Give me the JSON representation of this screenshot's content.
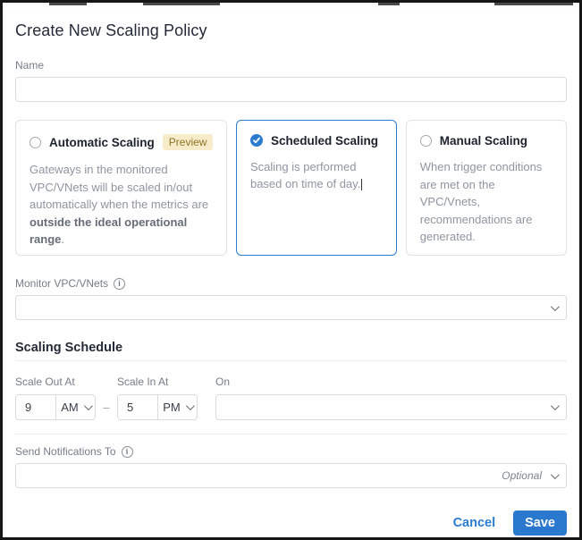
{
  "modal": {
    "title": "Create New Scaling Policy",
    "name_field": {
      "label": "Name",
      "value": ""
    },
    "policy_cards": [
      {
        "title": "Automatic Scaling",
        "badge": "Preview",
        "selected": false,
        "desc_normal": "Gateways in the monitored VPC/VNets will be scaled in/out automatically when the metrics are ",
        "desc_bold": "outside the ideal operational range",
        "desc_suffix": "."
      },
      {
        "title": "Scheduled Scaling",
        "selected": true,
        "description": "Scaling is performed based on time of day."
      },
      {
        "title": "Manual Scaling",
        "selected": false,
        "description": "When trigger conditions are met on the VPC/Vnets, recommendations are generated."
      }
    ],
    "monitor_field": {
      "label": "Monitor VPC/VNets",
      "value": ""
    },
    "schedule": {
      "heading": "Scaling Schedule",
      "scale_out": {
        "label": "Scale Out At",
        "hour": "9",
        "meridiem": "AM"
      },
      "range_separator": "–",
      "scale_in": {
        "label": "Scale In At",
        "hour": "5",
        "meridiem": "PM"
      },
      "on_field": {
        "label": "On",
        "value": ""
      }
    },
    "notifications_field": {
      "label": "Send Notifications To",
      "hint": "Optional",
      "value": ""
    },
    "footer": {
      "cancel": "Cancel",
      "save": "Save"
    }
  },
  "colors": {
    "accent": "#2d7bd0",
    "selected_card_border": "#2d7bd0",
    "badge_bg": "#f6ecc9",
    "badge_text": "#8f7326",
    "save_button_bg": "#2b79cf"
  }
}
